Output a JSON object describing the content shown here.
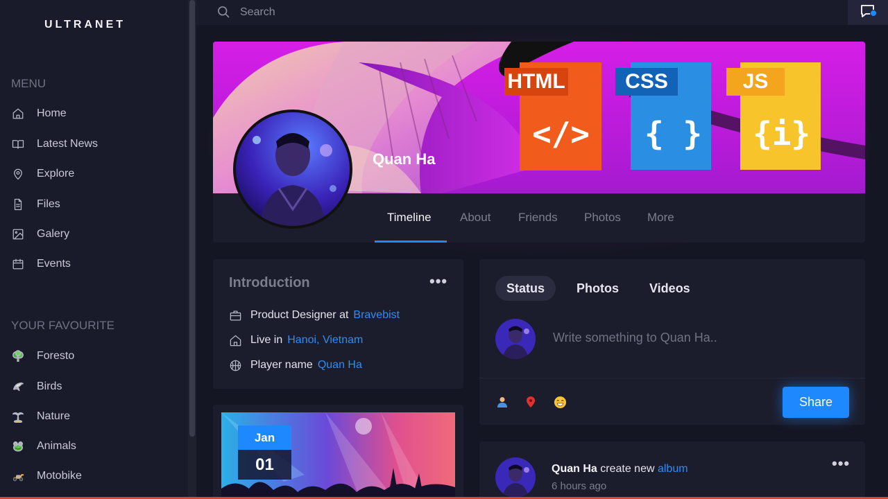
{
  "app": {
    "logo": "ULTRANET"
  },
  "search": {
    "placeholder": "Search"
  },
  "sidebar": {
    "menu_title": "MENU",
    "menu_items": [
      {
        "label": "Home",
        "icon": "home-icon"
      },
      {
        "label": "Latest News",
        "icon": "book-icon"
      },
      {
        "label": "Explore",
        "icon": "location-pin-icon"
      },
      {
        "label": "Files",
        "icon": "file-icon"
      },
      {
        "label": "Galery",
        "icon": "image-icon"
      },
      {
        "label": "Events",
        "icon": "calendar-icon"
      }
    ],
    "fav_title": "YOUR FAVOURITE",
    "fav_items": [
      {
        "label": "Foresto",
        "icon": "tree-icon"
      },
      {
        "label": "Birds",
        "icon": "bird-icon"
      },
      {
        "label": "Nature",
        "icon": "palm-tree-icon"
      },
      {
        "label": "Animals",
        "icon": "frog-icon"
      },
      {
        "label": "Motobike",
        "icon": "scooter-icon"
      }
    ]
  },
  "profile": {
    "name": "Quan Ha",
    "cover_badges": [
      "HTML",
      "CSS",
      "JS"
    ],
    "tabs": [
      "Timeline",
      "About",
      "Friends",
      "Photos",
      "More"
    ],
    "active_tab": "Timeline"
  },
  "intro": {
    "title": "Introduction",
    "rows": [
      {
        "label": "Product Designer at",
        "link": "Bravebist",
        "icon": "briefcase-icon"
      },
      {
        "label": "Live in",
        "link": "Hanoi, Vietnam",
        "icon": "home-icon"
      },
      {
        "label": "Player name",
        "link": "Quan Ha",
        "icon": "basketball-icon"
      }
    ]
  },
  "event": {
    "month": "Jan",
    "day": "01"
  },
  "composer": {
    "tabs": [
      "Status",
      "Photos",
      "Videos"
    ],
    "active_tab": "Status",
    "placeholder": "Write something to Quan Ha..",
    "share_label": "Share"
  },
  "post": {
    "author": "Quan Ha",
    "action": "create new",
    "object": "album",
    "time": "6 hours ago"
  },
  "colors": {
    "accent": "#1e88ff",
    "link": "#2f8cf0",
    "background": "#151623",
    "card": "#1c1d2c"
  }
}
